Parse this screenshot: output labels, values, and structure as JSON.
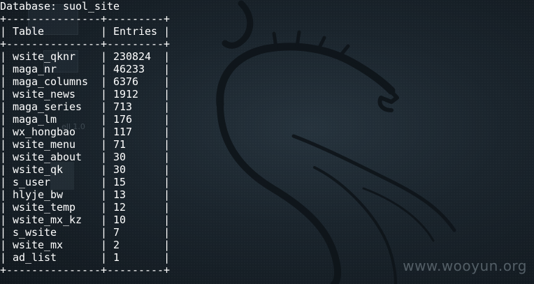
{
  "database_label": "Database: suol_site",
  "border": "+---------------+---------+",
  "columns": [
    "Table",
    "Entries"
  ],
  "rows": [
    {
      "table": "wsite_qknr",
      "entries": "230824"
    },
    {
      "table": "maga_nr",
      "entries": "46233"
    },
    {
      "table": "maga_columns",
      "entries": "6376"
    },
    {
      "table": "wsite_news",
      "entries": "1912"
    },
    {
      "table": "maga_series",
      "entries": "713"
    },
    {
      "table": "maga_lm",
      "entries": "176"
    },
    {
      "table": "wx_hongbao",
      "entries": "117"
    },
    {
      "table": "wsite_menu",
      "entries": "71"
    },
    {
      "table": "wsite_about",
      "entries": "30"
    },
    {
      "table": "wsite_qk",
      "entries": "30"
    },
    {
      "table": "s_user",
      "entries": "15"
    },
    {
      "table": "hlyje_bw",
      "entries": "13"
    },
    {
      "table": "wsite_temp",
      "entries": "12"
    },
    {
      "table": "wsite_mx_kz",
      "entries": "10"
    },
    {
      "table": "s_wsite",
      "entries": "7"
    },
    {
      "table": "wsite_mx",
      "entries": "2"
    },
    {
      "table": "ad_list",
      "entries": "1"
    }
  ],
  "watermark": "www.wooyun.org",
  "desktop_ghost_text": "ell 1.0",
  "colors": {
    "terminal_text": "#ffffff",
    "background": "#1a242c",
    "dragon": "#0e1419"
  }
}
